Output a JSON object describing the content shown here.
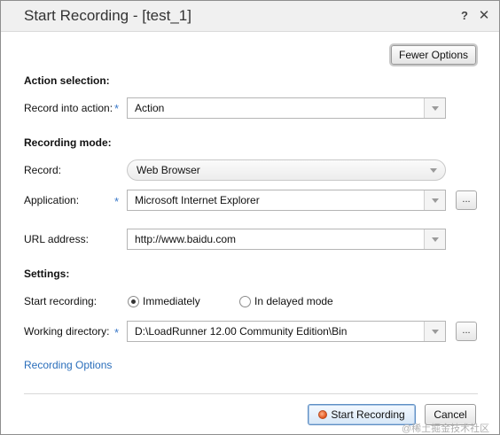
{
  "window": {
    "title": "Start Recording - [test_1]",
    "help_glyph": "?",
    "close_glyph": "✕"
  },
  "toolbar": {
    "fewer_options_label": "Fewer Options"
  },
  "action_selection": {
    "heading": "Action selection:",
    "record_into_label": "Record into action:",
    "record_into_value": "Action"
  },
  "recording_mode": {
    "heading": "Recording mode:",
    "record_label": "Record:",
    "record_value": "Web Browser",
    "application_label": "Application:",
    "application_value": "Microsoft Internet Explorer",
    "url_label": "URL address:",
    "url_value": "http://www.baidu.com"
  },
  "settings": {
    "heading": "Settings:",
    "start_recording_label": "Start recording:",
    "option_immediately": "Immediately",
    "option_delayed": "In delayed mode",
    "selected_option": "Immediately",
    "working_dir_label": "Working directory:",
    "working_dir_value": "D:\\LoadRunner 12.00 Community Edition\\Bin"
  },
  "links": {
    "recording_options": "Recording Options"
  },
  "footer": {
    "start_recording_label": "Start Recording",
    "cancel_label": "Cancel"
  },
  "required_marker": "*",
  "browse_label": "...",
  "watermark": "@稀土掘金技术社区",
  "colors": {
    "accent_link": "#2a6ebb",
    "required_star": "#3a78c8",
    "record_dot": "#e0531b"
  }
}
